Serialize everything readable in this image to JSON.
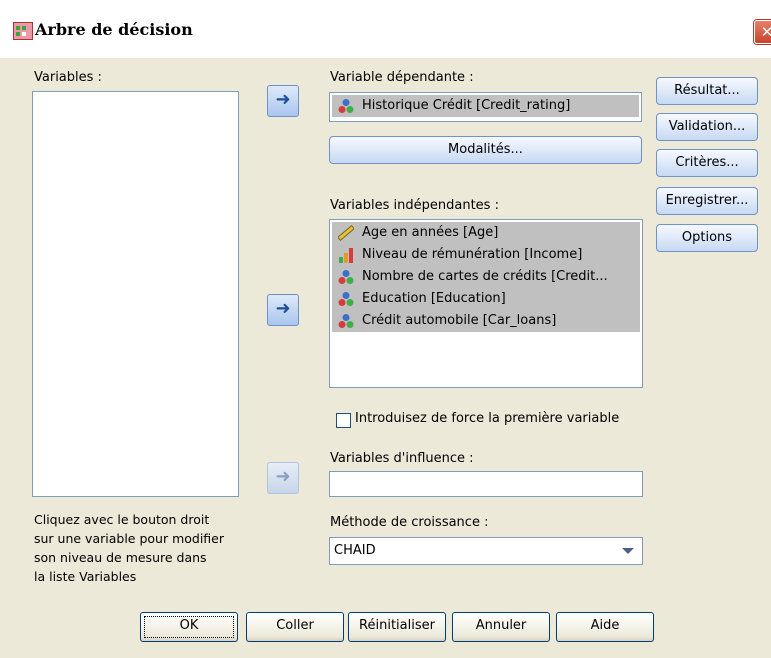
{
  "window": {
    "title": "Arbre de décision",
    "close_label": "✕"
  },
  "left": {
    "variables_label": "Variables :",
    "hint_lines": [
      "Cliquez avec le bouton droit",
      "sur une variable pour modifier",
      "son niveau de mesure dans",
      "la liste Variables"
    ]
  },
  "dependent": {
    "label": "Variable dépendante :",
    "value": "Historique Crédit [Credit_rating]",
    "modalites_label": "Modalités..."
  },
  "independent": {
    "label": "Variables indépendantes :",
    "items": [
      {
        "label": "Age en années [Age]",
        "icon": "ruler-icon"
      },
      {
        "label": "Niveau de rémunération [Income]",
        "icon": "bar-chart-icon"
      },
      {
        "label": "Nombre de cartes de crédits [Credit...",
        "icon": "nominal-icon"
      },
      {
        "label": "Education [Education]",
        "icon": "nominal-icon"
      },
      {
        "label": "Crédit automobile [Car_loans]",
        "icon": "nominal-icon"
      }
    ]
  },
  "force_first": {
    "label": "Introduisez de force la première variable",
    "checked": false
  },
  "influence": {
    "label": "Variables d'influence :",
    "value": ""
  },
  "growth": {
    "label": "Méthode de croissance :",
    "value": "CHAID"
  },
  "side_buttons": [
    "Résultat...",
    "Validation...",
    "Critères...",
    "Enregistrer...",
    "Options"
  ],
  "bottom_buttons": [
    "OK",
    "Coller",
    "Réinitialiser",
    "Annuler",
    "Aide"
  ],
  "colors": {
    "dialog_bg": "#ece9d8",
    "accent": "#6f93c9",
    "selection": "#c0c0c0"
  }
}
